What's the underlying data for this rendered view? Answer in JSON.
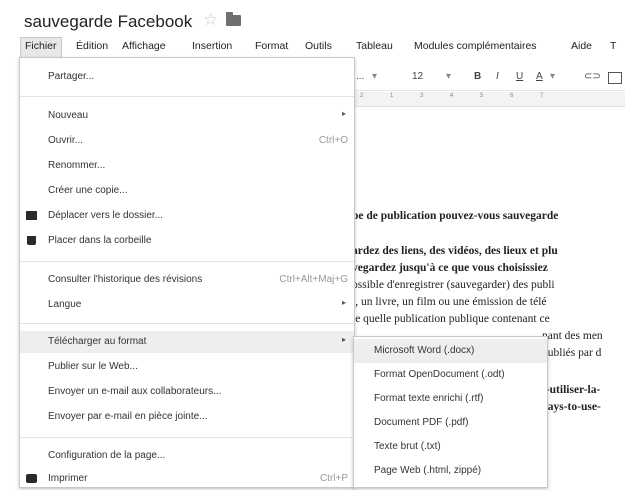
{
  "title_bar": {
    "doc_title": "sauvegarde Facebook"
  },
  "menubar": [
    "Fichier",
    "Édition",
    "Affichage",
    "Insertion",
    "Format",
    "Outils",
    "Tableau",
    "Modules complémentaires",
    "Aide",
    "T"
  ],
  "toolbar": {
    "font_dropdown": "...",
    "font_size": "12",
    "bold": "B",
    "italic": "I",
    "underline": "U",
    "text_color": "A",
    "link": "⊂⊃"
  },
  "ruler": [
    "2",
    "1",
    "3",
    "4",
    "5",
    "6",
    "7"
  ],
  "file_menu": {
    "share": "Partager...",
    "new": "Nouveau",
    "open": "Ouvrir...",
    "open_shortcut": "Ctrl+O",
    "rename": "Renommer...",
    "copy": "Créer une copie...",
    "move": "Déplacer vers le dossier...",
    "trash": "Placer dans la corbeille",
    "history": "Consulter l'historique des révisions",
    "history_shortcut": "Ctrl+Alt+Maj+G",
    "language": "Langue",
    "download": "Télécharger au format",
    "publish": "Publier sur le Web...",
    "email_collab": "Envoyer un e-mail aux collaborateurs...",
    "email_attach": "Envoyer par e-mail en pièce jointe...",
    "page_setup": "Configuration de la page...",
    "print": "Imprimer",
    "print_shortcut": "Ctrl+P"
  },
  "download_submenu": [
    "Microsoft Word (.docx)",
    "Format OpenDocument (.odt)",
    "Format texte enrichi (.rtf)",
    "Document PDF (.pdf)",
    "Texte brut (.txt)",
    "Page Web (.html, zippé)"
  ],
  "document": [
    "pe de publication pouvez-vous sauvegarde",
    "ardez des liens, des vidéos, des lieux et plu",
    "vegardez jusqu'à ce que vous choisissiez",
    "ossible d'enregistrer (sauvegarder) des publi",
    "t, un livre, un film ou une émission de télé",
    "te quelle publication publique contenant ce",
    "nant des men",
    "publiés par d",
    "t-utiliser-la-",
    "vays-to-use-"
  ]
}
